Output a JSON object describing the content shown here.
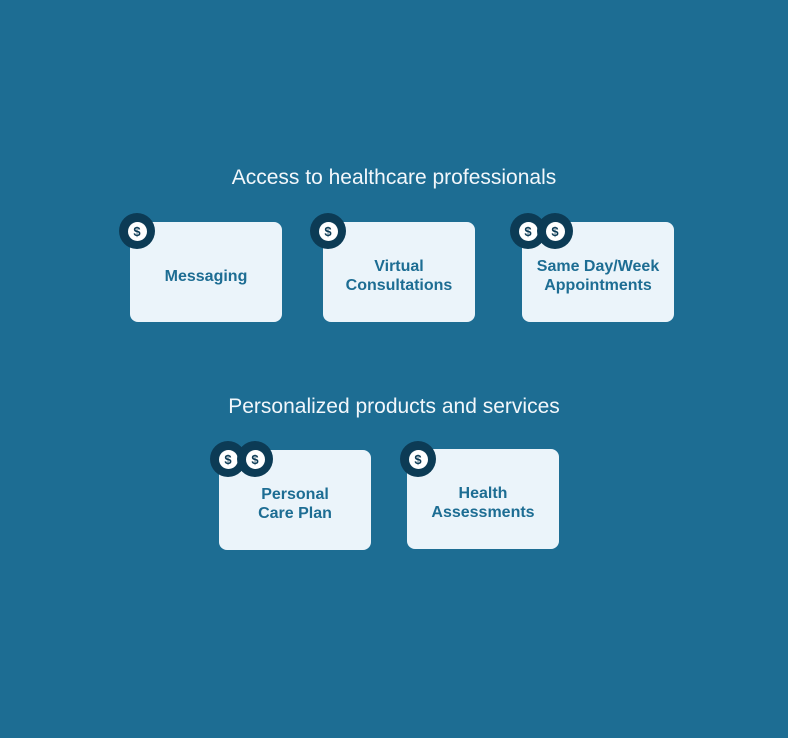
{
  "sections": [
    {
      "title": "Access to healthcare professionals",
      "items": [
        {
          "label": "Messaging",
          "cost_icons": 1
        },
        {
          "label": "Virtual\nConsultations",
          "cost_icons": 1
        },
        {
          "label": "Same Day/Week\nAppointments",
          "cost_icons": 2
        }
      ]
    },
    {
      "title": "Personalized products and services",
      "items": [
        {
          "label": "Personal\nCare Plan",
          "cost_icons": 2
        },
        {
          "label": "Health\nAssessments",
          "cost_icons": 1
        }
      ]
    }
  ],
  "icon": {
    "name": "dollar-icon",
    "glyph": "$"
  },
  "colors": {
    "background": "#1d6d93",
    "card": "#ebf4fa",
    "badge": "#0c3b55"
  }
}
